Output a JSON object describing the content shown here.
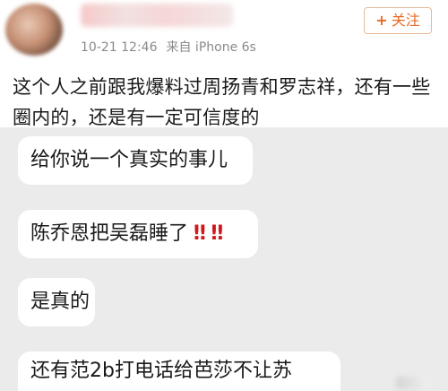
{
  "post": {
    "timestamp": "10-21 12:46",
    "source": "来自 iPhone 6s",
    "follow_label": "关注",
    "follow_plus": "+",
    "text": "这个人之前跟我爆料过周扬青和罗志祥，还有一些圈内的，还是有一定可信度的"
  },
  "chat": {
    "messages": [
      "给你说一个真实的事儿",
      "陈乔恩把吴磊睡了",
      "是真的",
      "还有范2b打电话给芭莎不让苏"
    ],
    "exclaim": "‼ ‼"
  },
  "colors": {
    "accent": "#e86a25",
    "exclaim": "#d0171b",
    "chat_bg": "#ebebeb"
  },
  "icons": [
    "avatar",
    "plus-icon"
  ]
}
